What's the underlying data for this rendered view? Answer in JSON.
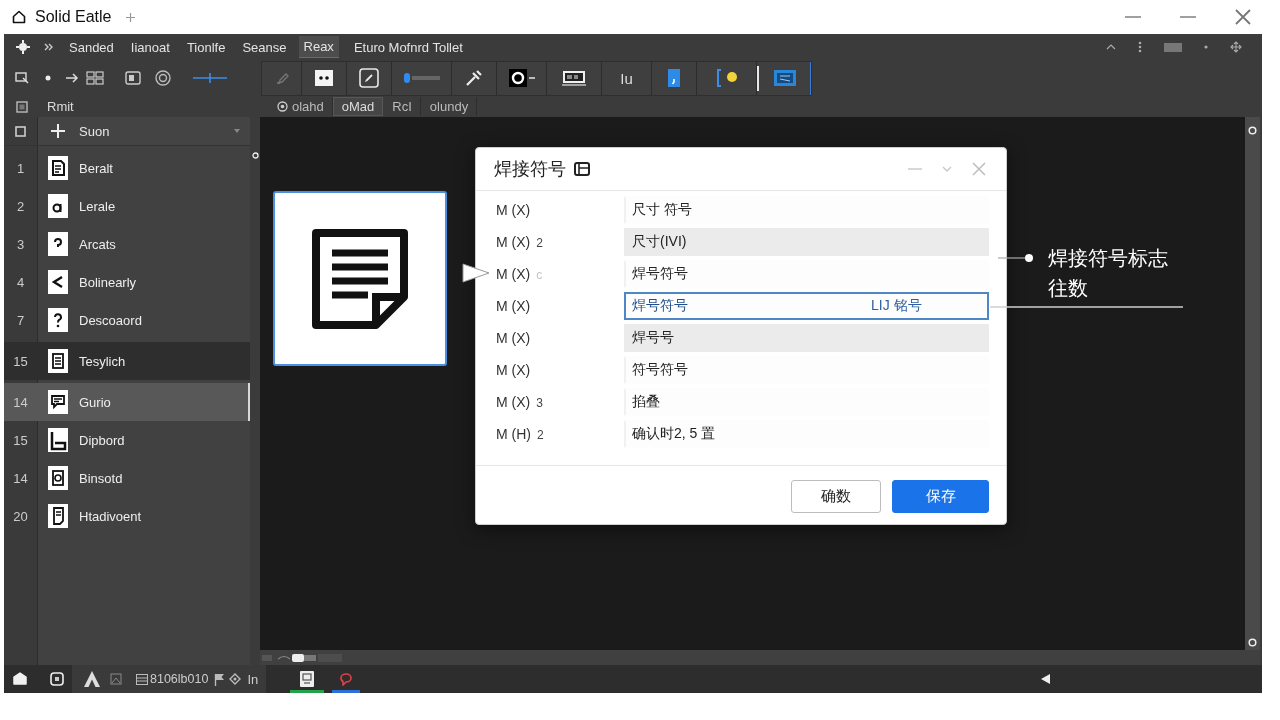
{
  "window": {
    "title": "Solid Eatle"
  },
  "menu": [
    {
      "label": "Sanded",
      "selected": false
    },
    {
      "label": "Iianoat",
      "selected": false
    },
    {
      "label": "Tionlfe",
      "selected": false
    },
    {
      "label": "Seanse",
      "selected": false
    },
    {
      "label": "Reax",
      "selected": true
    },
    {
      "label": "Eturo Mofnrd Tollet",
      "selected": false
    }
  ],
  "toolbar": {
    "text_tool": "Iu"
  },
  "sidebar": {
    "title": "Rmit",
    "header": "Suon",
    "items": [
      {
        "number": "1",
        "label": "Beralt",
        "selected": false,
        "shaded": false
      },
      {
        "number": "2",
        "label": "Lerale",
        "selected": false,
        "shaded": false
      },
      {
        "number": "3",
        "label": "Arcats",
        "selected": false,
        "shaded": false
      },
      {
        "number": "4",
        "label": "Bolinearly",
        "selected": false,
        "shaded": false
      },
      {
        "number": "7",
        "label": "Descoaord",
        "selected": false,
        "shaded": false
      },
      {
        "number": "15",
        "label": "Tesylich",
        "selected": false,
        "shaded": true
      },
      {
        "number": "14",
        "label": "Gurio",
        "selected": true,
        "shaded": false
      },
      {
        "number": "15",
        "label": "Dipbord",
        "selected": false,
        "shaded": false
      },
      {
        "number": "14",
        "label": "Binsotd",
        "selected": false,
        "shaded": false
      },
      {
        "number": "20",
        "label": "Htadivoent",
        "selected": false,
        "shaded": false
      }
    ]
  },
  "tabs": [
    {
      "label": "olahd",
      "icon": true,
      "selected": false
    },
    {
      "label": "oMad",
      "icon": false,
      "selected": true
    },
    {
      "label": "RcI",
      "icon": false,
      "selected": false
    },
    {
      "label": "olundy",
      "icon": false,
      "selected": false
    }
  ],
  "canvas": {
    "callout": "焊接符号标志往数"
  },
  "dialog": {
    "title": "焊接符号",
    "rows": [
      {
        "label": "M (X)",
        "value": "尺寸 符号",
        "shaded": false,
        "focused": false
      },
      {
        "label": "M (X)",
        "suffix": "2",
        "suffix_faint": false,
        "value": "尺寸(IVI)",
        "shaded": true,
        "focused": false
      },
      {
        "label": "M (X)",
        "suffix": "c",
        "suffix_faint": true,
        "value": "焊号符号",
        "shaded": false,
        "focused": false
      },
      {
        "label": "M (X)",
        "value": "焊号符号",
        "value_2": "LIJ 铭号",
        "shaded": false,
        "focused": true
      },
      {
        "label": "M (X)",
        "value": "焊号号",
        "shaded": true,
        "focused": false
      },
      {
        "label": "M (X)",
        "value": "符号符号",
        "shaded": false,
        "focused": false
      },
      {
        "label": "M (X)",
        "suffix": "3",
        "suffix_faint": false,
        "value": "掐叠",
        "shaded": false,
        "focused": false
      },
      {
        "label": "M (H)",
        "suffix": "2",
        "suffix_faint": false,
        "value": "确认时2, 5 置",
        "shaded": false,
        "focused": false
      }
    ],
    "buttons": [
      {
        "label": "确数",
        "kind": "secondary"
      },
      {
        "label": "保存",
        "kind": "primary"
      }
    ]
  },
  "taskbar": {
    "readout": "8106lb010",
    "unit": "In",
    "apps": [
      {
        "color": "#22a34a"
      },
      {
        "color": "#2b6fd8"
      }
    ]
  }
}
